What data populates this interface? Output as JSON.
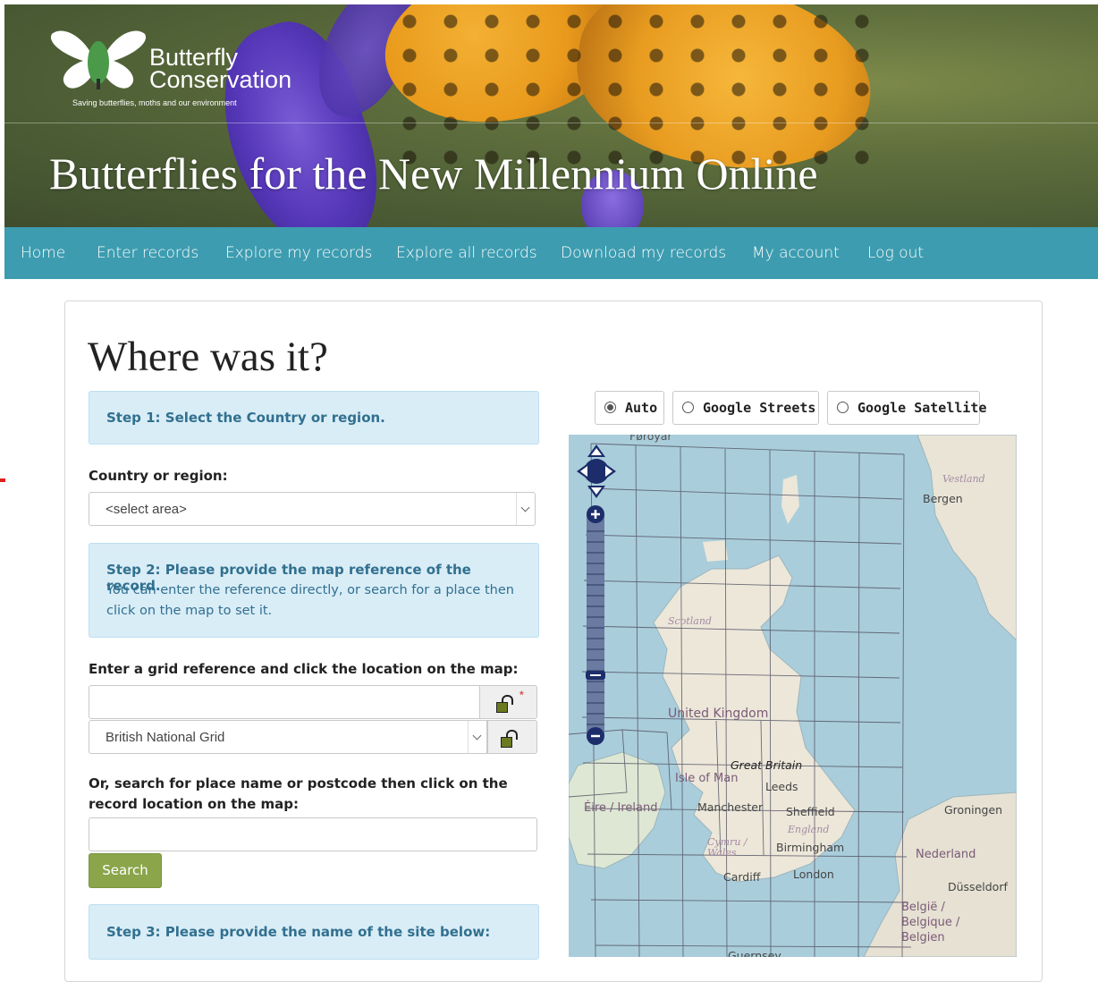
{
  "header": {
    "org_name_line1": "Butterfly",
    "org_name_line2": "Conservation",
    "tagline": "Saving butterflies, moths and our environment",
    "site_title": "Butterflies for the New Millennium Online"
  },
  "nav": {
    "items": [
      {
        "label": "Home"
      },
      {
        "label": "Enter records"
      },
      {
        "label": "Explore my records"
      },
      {
        "label": "Explore all records"
      },
      {
        "label": "Download my records"
      },
      {
        "label": "My account"
      },
      {
        "label": "Log out"
      }
    ]
  },
  "page": {
    "title": "Where was it?"
  },
  "step1": {
    "title": "Step 1: Select the Country or region."
  },
  "country": {
    "label": "Country or region:",
    "selected": "<select area>"
  },
  "step2": {
    "title": "Step 2: Please provide the map reference of the record.",
    "body": "You can enter the reference directly, or search for a place then click on the map to set it."
  },
  "gridref": {
    "label": "Enter a grid reference and click the location on the map:",
    "value": "",
    "required_marker": "*",
    "system_selected": "British National Grid"
  },
  "place_search": {
    "label": "Or, search for place name or postcode then click on the record location on the map:",
    "value": "",
    "button": "Search"
  },
  "step3": {
    "title": "Step 3: Please provide the name of the site below:"
  },
  "map_layers": {
    "options": [
      "Auto",
      "Google Streets",
      "Google Satellite"
    ],
    "selected": "Auto"
  },
  "map": {
    "labels": {
      "faroe": "Føroyar",
      "vestland": "Vestland",
      "bergen": "Bergen",
      "scotland": "Scotland",
      "uk": "United Kingdom",
      "great_britain": "Great Britain",
      "isle_of_man": "Isle of Man",
      "leeds": "Leeds",
      "ireland": "Éire / Ireland",
      "manchester": "Manchester",
      "sheffield": "Sheffield",
      "england": "England",
      "groningen": "Groningen",
      "wales": "Cymru / Wales",
      "birmingham": "Birmingham",
      "nederland": "Nederland",
      "cardiff": "Cardiff",
      "london": "London",
      "dusseldorf": "Düsseldorf",
      "belgium": "België / Belgique / Belgien",
      "guernsey": "Guernsey"
    }
  }
}
